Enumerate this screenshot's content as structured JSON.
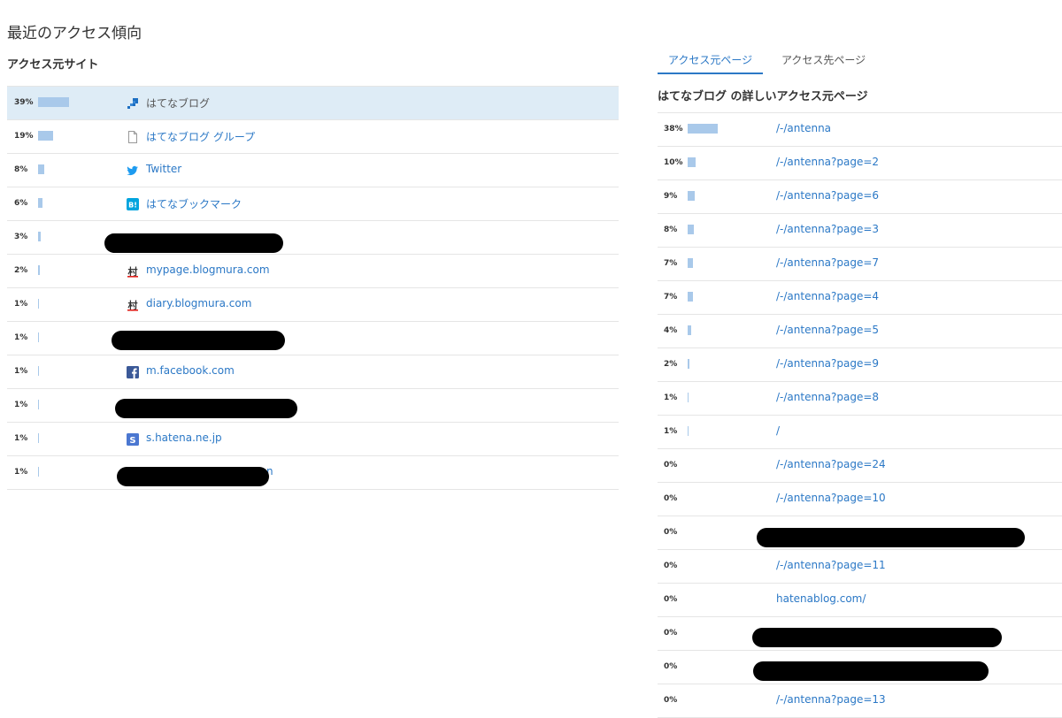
{
  "page_title": "最近のアクセス傾向",
  "sites_section": {
    "title": "アクセス元サイト",
    "rows": [
      {
        "percent": "39%",
        "share": 0.39,
        "icon": "hatena-blog-icon",
        "label": "はてなブログ"
      },
      {
        "percent": "19%",
        "share": 0.19,
        "icon": "document-icon",
        "label": "はてなブログ グループ"
      },
      {
        "percent": "8%",
        "share": 0.08,
        "icon": "twitter-bird-icon",
        "label": "Twitter"
      },
      {
        "percent": "6%",
        "share": 0.06,
        "icon": "hatena-bookmark-icon",
        "label": "はてなブックマーク"
      },
      {
        "percent": "3%",
        "share": 0.03,
        "icon": null,
        "label": null
      },
      {
        "percent": "2%",
        "share": 0.02,
        "icon": "blogmura-icon",
        "label": "mypage.blogmura.com"
      },
      {
        "percent": "1%",
        "share": 0.01,
        "icon": "blogmura-icon",
        "label": "diary.blogmura.com"
      },
      {
        "percent": "1%",
        "share": 0.01,
        "icon": null,
        "label": null
      },
      {
        "percent": "1%",
        "share": 0.01,
        "icon": "facebook-icon",
        "label": "m.facebook.com"
      },
      {
        "percent": "1%",
        "share": 0.01,
        "icon": null,
        "label": null
      },
      {
        "percent": "1%",
        "share": 0.01,
        "icon": "hatena-star-icon",
        "label": "s.hatena.ne.jp"
      },
      {
        "percent": "1%",
        "share": 0.01,
        "icon": null,
        "label": "n"
      }
    ]
  },
  "tabs": [
    {
      "label": "アクセス元ページ",
      "active": true
    },
    {
      "label": "アクセス先ページ",
      "active": false
    }
  ],
  "detail": {
    "title": "はてなブログ の詳しいアクセス元ページ",
    "rows": [
      {
        "percent": "38%",
        "share": 0.38,
        "label": "/-/antenna"
      },
      {
        "percent": "10%",
        "share": 0.1,
        "label": "/-/antenna?page=2"
      },
      {
        "percent": "9%",
        "share": 0.09,
        "label": "/-/antenna?page=6"
      },
      {
        "percent": "8%",
        "share": 0.08,
        "label": "/-/antenna?page=3"
      },
      {
        "percent": "7%",
        "share": 0.07,
        "label": "/-/antenna?page=7"
      },
      {
        "percent": "7%",
        "share": 0.07,
        "label": "/-/antenna?page=4"
      },
      {
        "percent": "4%",
        "share": 0.04,
        "label": "/-/antenna?page=5"
      },
      {
        "percent": "2%",
        "share": 0.02,
        "label": "/-/antenna?page=9"
      },
      {
        "percent": "1%",
        "share": 0.01,
        "label": "/-/antenna?page=8"
      },
      {
        "percent": "1%",
        "share": 0.01,
        "label": "/"
      },
      {
        "percent": "0%",
        "share": 0.0,
        "label": "/-/antenna?page=24"
      },
      {
        "percent": "0%",
        "share": 0.0,
        "label": "/-/antenna?page=10"
      },
      {
        "percent": "0%",
        "share": 0.0,
        "label": null
      },
      {
        "percent": "0%",
        "share": 0.0,
        "label": "/-/antenna?page=11"
      },
      {
        "percent": "0%",
        "share": 0.0,
        "label": "hatenablog.com/"
      },
      {
        "percent": "0%",
        "share": 0.0,
        "label": null
      },
      {
        "percent": "0%",
        "share": 0.0,
        "label": null
      },
      {
        "percent": "0%",
        "share": 0.0,
        "label": "/-/antenna?page=13"
      }
    ]
  },
  "colors": {
    "link": "#2b78c6",
    "bar": "#a9c9ea",
    "selected_row": "#deecf6",
    "divider": "#e5e5e5",
    "redaction": "#000000"
  }
}
